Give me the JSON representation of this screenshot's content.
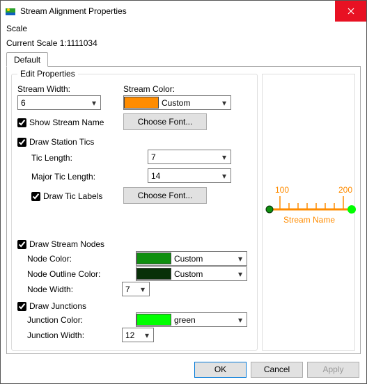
{
  "window": {
    "title": "Stream Alignment Properties"
  },
  "menu": {
    "scale": "Scale"
  },
  "scale": {
    "label": "Current Scale 1:1111034"
  },
  "tabs": {
    "default": "Default"
  },
  "group": {
    "edit": "Edit Properties"
  },
  "labels": {
    "streamWidth": "Stream Width:",
    "streamColor": "Stream Color:",
    "showStreamName": "Show Stream Name",
    "chooseFont": "Choose Font...",
    "drawStationTics": "Draw Station Tics",
    "ticLength": "Tic Length:",
    "majorTicLength": "Major Tic Length:",
    "drawTicLabels": "Draw Tic Labels",
    "drawStreamNodes": "Draw Stream Nodes",
    "nodeColor": "Node Color:",
    "nodeOutlineColor": "Node Outline Color:",
    "nodeWidth": "Node Width:",
    "drawJunctions": "Draw Junctions",
    "junctionColor": "Junction Color:",
    "junctionWidth": "Junction Width:"
  },
  "values": {
    "streamWidth": "6",
    "streamColorName": "Custom",
    "streamColorHex": "#ff8c00",
    "ticLength": "7",
    "majorTicLength": "14",
    "nodeColorName": "Custom",
    "nodeColorHex": "#0f8f0f",
    "nodeOutlineColorName": "Custom",
    "nodeOutlineColorHex": "#083008",
    "nodeWidth": "7",
    "junctionColorName": "green",
    "junctionColorHex": "#00ff00",
    "junctionWidth": "12"
  },
  "preview": {
    "tick1": "100",
    "tick2": "200",
    "streamName": "Stream Name"
  },
  "buttons": {
    "ok": "OK",
    "cancel": "Cancel",
    "apply": "Apply"
  }
}
